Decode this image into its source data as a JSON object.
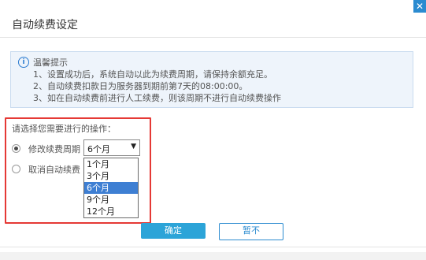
{
  "dialog": {
    "title": "自动续费设定",
    "close_icon": "close-icon"
  },
  "tips": {
    "icon": "info-icon",
    "title": "温馨提示",
    "lines": [
      "1、设置成功后，系统自动以此为续费周期，请保持余额充足。",
      "2、自动续费扣款日为服务器到期前第7天的08:00:00。",
      "3、如在自动续费前进行人工续费，则该周期不进行自动续费操作"
    ]
  },
  "operation": {
    "prompt": "请选择您需要进行的操作：",
    "options": [
      {
        "label": "修改续费周期",
        "checked": true
      },
      {
        "label": "取消自动续费",
        "checked": false
      }
    ],
    "select": {
      "value": "6个月",
      "arrow_icon": "dropdown-arrow-icon",
      "options": [
        "1个月",
        "3个月",
        "6个月",
        "9个月",
        "12个月"
      ],
      "highlighted": "6个月"
    }
  },
  "buttons": {
    "ok": "确定",
    "cancel": "暂不"
  },
  "colors": {
    "accent": "#2b8bd0",
    "highlight": "#e53935",
    "ok_button": "#2ca4d8"
  }
}
